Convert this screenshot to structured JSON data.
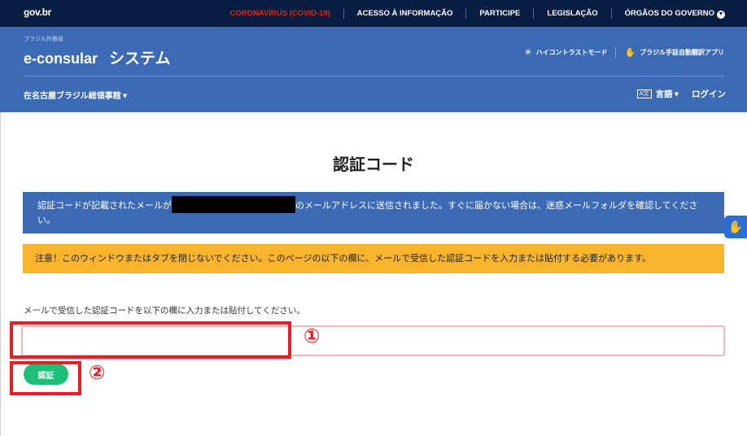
{
  "govbar": {
    "logo": "gov.br",
    "links": [
      "CORONAVÍRUS (COVID-19)",
      "ACESSO À INFORMAÇÃO",
      "PARTICIPE",
      "LEGISLAÇÃO",
      "ÓRGÃOS DO GOVERNO"
    ],
    "chevron_icon": "chevron-down"
  },
  "header": {
    "small_brand": "ブラジル外務省",
    "title": "e-consular",
    "title_suffix": "システム",
    "tools": [
      {
        "icon": "sun-icon",
        "icon_glyph": "☀",
        "label": "ハイコントラストモード"
      },
      {
        "icon": "hand-icon",
        "icon_glyph": "✋",
        "label": "ブラジル手話自動翻訳アプリ"
      }
    ],
    "consulate": "在名古屋ブラジル総領事館",
    "language_icon_text": "A文",
    "language": "言語",
    "login": "ログイン"
  },
  "main": {
    "page_title": "認証コード",
    "info_before": "認証コードが記載されたメールが",
    "info_after": "のメールアドレスに送信されました。すぐに届かない場合は、迷惑メールフォルダを確認してください。",
    "warning": "注意！このウィンドウまたはタブを閉じないでください。このページの以下の欄に、メールで受信した認証コードを入力または貼付する必要があります。",
    "instruction": "メールで受信した認証コードを以下の欄に入力または貼付してください。",
    "code_value": "",
    "submit_label": "認証"
  },
  "annotations": {
    "one": "①",
    "two": "②"
  },
  "colors": {
    "govbar": "#071D41",
    "header": "#3C6AB4",
    "info": "#3C6AB4",
    "warning": "#F9B42D",
    "button": "#1FBF7A",
    "annotation": "#ED1C24",
    "corona": "#E52207"
  }
}
